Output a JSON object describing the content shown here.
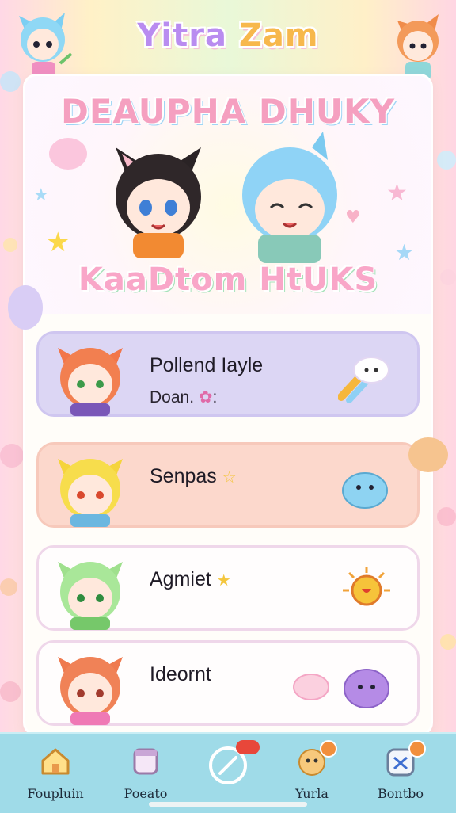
{
  "app": {
    "brand_word1": "Yitra",
    "brand_word2": "Zam"
  },
  "hero": {
    "title": "DEAUPHA DHUKY",
    "subtitle": "KaaDtom HtUKS"
  },
  "list": [
    {
      "name": "Pollend Iayle",
      "sub": "Doan.",
      "color": "#dcd6f4",
      "border": "#cfc6f0"
    },
    {
      "name": "Senpas",
      "sub": "",
      "color": "#fcd8cc",
      "border": "#f7c9bb"
    },
    {
      "name": "Agmiet",
      "sub": "",
      "color": "#fffdfd",
      "border": "#efd7ea"
    },
    {
      "name": "Ideornt",
      "sub": "",
      "color": "#fffdfd",
      "border": "#efd7ea"
    }
  ],
  "nav": [
    {
      "label": "Foupluin",
      "icon": "house-icon"
    },
    {
      "label": "Poeato",
      "icon": "cup-icon"
    },
    {
      "label": "",
      "icon": "compass-icon"
    },
    {
      "label": "Yurla",
      "icon": "cookie-icon"
    },
    {
      "label": "Bontbo",
      "icon": "game-icon"
    }
  ],
  "colors": {
    "accent_purple": "#b98cf0",
    "accent_orange": "#f7b84c",
    "bar": "#9fdbe8"
  }
}
